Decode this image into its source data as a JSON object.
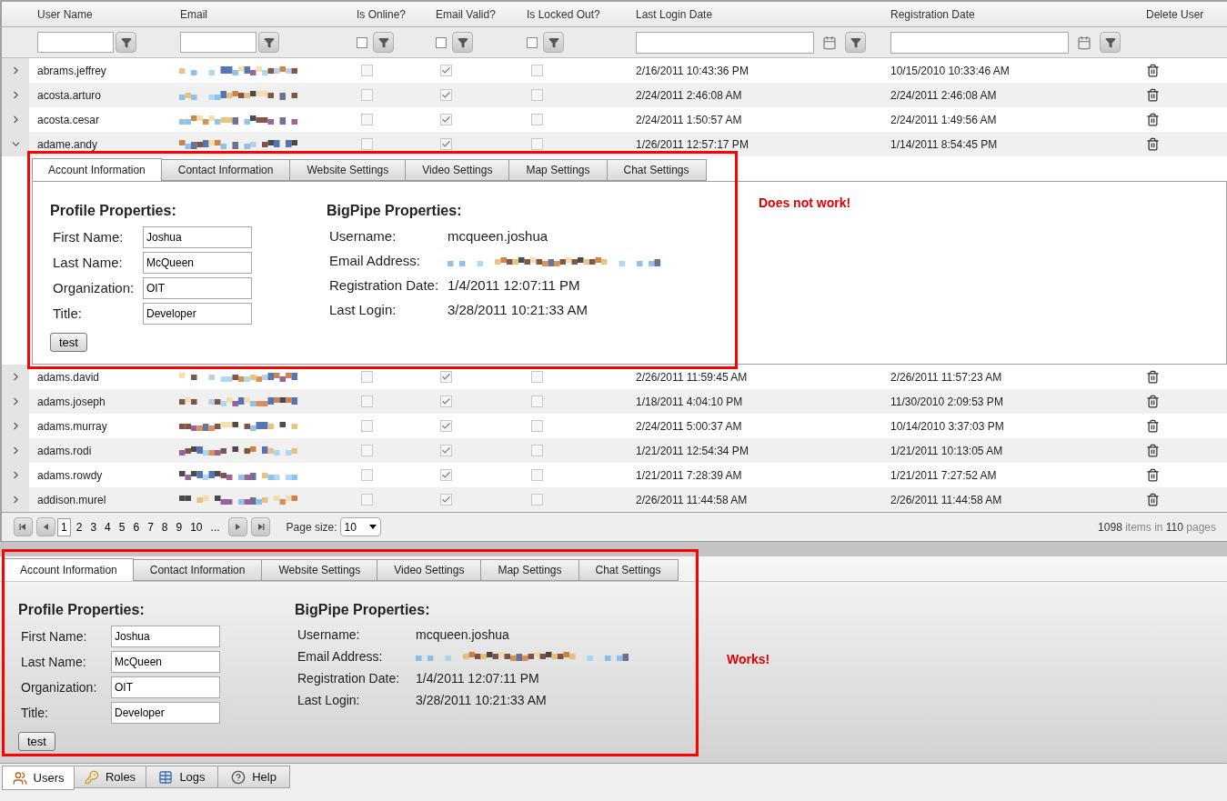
{
  "grid": {
    "checkbox_filters": [
      {
        "checked": false
      },
      {
        "checked": false
      },
      {
        "checked": false
      }
    ],
    "columns": [
      "User Name",
      "Email",
      "Is Online?",
      "Email Valid?",
      "Is Locked Out?",
      "Last Login Date",
      "Registration Date",
      "Delete User"
    ],
    "rows_before": [
      {
        "user": "abrams.jeffrey",
        "online": false,
        "valid": true,
        "locked": false,
        "last_login": "2/16/2011 10:43:36 PM",
        "registered": "10/15/2010 10:33:46 AM",
        "expanded": false
      },
      {
        "user": "acosta.arturo",
        "online": false,
        "valid": true,
        "locked": false,
        "last_login": "2/24/2011 2:46:08 AM",
        "registered": "2/24/2011 2:46:08 AM",
        "expanded": false
      },
      {
        "user": "acosta.cesar",
        "online": false,
        "valid": true,
        "locked": false,
        "last_login": "2/24/2011 1:50:57 AM",
        "registered": "2/24/2011 1:49:56 AM",
        "expanded": false
      },
      {
        "user": "adame.andy",
        "online": false,
        "valid": true,
        "locked": false,
        "last_login": "1/26/2011 12:57:17 PM",
        "registered": "1/14/2011 8:54:45 PM",
        "expanded": true
      }
    ],
    "rows_after": [
      {
        "user": "adams.david",
        "online": false,
        "valid": true,
        "locked": false,
        "last_login": "2/26/2011 11:59:45 AM",
        "registered": "2/26/2011 11:57:23 AM",
        "expanded": false
      },
      {
        "user": "adams.joseph",
        "online": false,
        "valid": true,
        "locked": false,
        "last_login": "1/18/2011 4:04:10 PM",
        "registered": "11/30/2010 2:09:53 PM",
        "expanded": false
      },
      {
        "user": "adams.murray",
        "online": false,
        "valid": true,
        "locked": false,
        "last_login": "2/24/2011 5:00:37 AM",
        "registered": "10/14/2010 3:37:03 PM",
        "expanded": false
      },
      {
        "user": "adams.rodi",
        "online": false,
        "valid": true,
        "locked": false,
        "last_login": "1/21/2011 12:54:34 PM",
        "registered": "1/21/2011 10:13:05 AM",
        "expanded": false
      },
      {
        "user": "adams.rowdy",
        "online": false,
        "valid": true,
        "locked": false,
        "last_login": "1/21/2011 7:28:39 AM",
        "registered": "1/21/2011 7:27:52 AM",
        "expanded": false
      },
      {
        "user": "addison.murel",
        "online": false,
        "valid": true,
        "locked": false,
        "last_login": "2/26/2011 11:44:58 AM",
        "registered": "2/26/2011 11:44:58 AM",
        "expanded": false
      }
    ]
  },
  "detail_panel": {
    "tabs": [
      {
        "label": "Account Information",
        "selected": true
      },
      {
        "label": "Contact Information",
        "selected": false
      },
      {
        "label": "Website Settings",
        "selected": false
      },
      {
        "label": "Video Settings",
        "selected": false
      },
      {
        "label": "Map Settings",
        "selected": false
      },
      {
        "label": "Chat Settings",
        "selected": false
      }
    ],
    "profile_title": "Profile Properties:",
    "profile_fields": [
      {
        "label": "First Name:",
        "value": "Joshua"
      },
      {
        "label": "Last Name:",
        "value": "McQueen"
      },
      {
        "label": "Organization:",
        "value": "OIT"
      },
      {
        "label": "Title:",
        "value": "Developer"
      }
    ],
    "button": "test",
    "bigpipe_title": "BigPipe Properties:",
    "bigpipe_fields": [
      {
        "label": "Username:",
        "value": "mcqueen.joshua"
      },
      {
        "label": "Email Address:"
      },
      {
        "label": "Registration Date:",
        "value": "1/4/2011 12:07:11 PM"
      },
      {
        "label": "Last Login:",
        "value": "3/28/2011 10:21:33 AM"
      }
    ],
    "note": "Does not work!"
  },
  "pager": {
    "pages": [
      {
        "label": "1",
        "selected": true
      },
      {
        "label": "2",
        "selected": false
      },
      {
        "label": "3",
        "selected": false
      },
      {
        "label": "4",
        "selected": false
      },
      {
        "label": "5",
        "selected": false
      },
      {
        "label": "6",
        "selected": false
      },
      {
        "label": "7",
        "selected": false
      },
      {
        "label": "8",
        "selected": false
      },
      {
        "label": "9",
        "selected": false
      },
      {
        "label": "10",
        "selected": false
      },
      {
        "label": "...",
        "selected": false
      }
    ],
    "page_size_label": "Page size:",
    "page_size": "10",
    "summary": [
      "1098",
      "items in",
      "110",
      "pages"
    ]
  },
  "bottom_panel": {
    "tabs": [
      {
        "label": "Account Information",
        "selected": true
      },
      {
        "label": "Contact Information",
        "selected": false
      },
      {
        "label": "Website Settings",
        "selected": false
      },
      {
        "label": "Video Settings",
        "selected": false
      },
      {
        "label": "Map Settings",
        "selected": false
      },
      {
        "label": "Chat Settings",
        "selected": false
      }
    ],
    "profile_title": "Profile Properties:",
    "profile_fields": [
      {
        "label": "First Name:",
        "value": "Joshua"
      },
      {
        "label": "Last Name:",
        "value": "McQueen"
      },
      {
        "label": "Organization:",
        "value": "OIT"
      },
      {
        "label": "Title:",
        "value": "Developer"
      }
    ],
    "button": "test",
    "bigpipe_title": "BigPipe Properties:",
    "bigpipe_fields": [
      {
        "label": "Username:",
        "value": "mcqueen.joshua"
      },
      {
        "label": "Email Address:"
      },
      {
        "label": "Registration Date:",
        "value": "1/4/2011 12:07:11 PM"
      },
      {
        "label": "Last Login:",
        "value": "3/28/2011 10:21:33 AM"
      }
    ],
    "note": "Works!"
  },
  "app_tabs": [
    {
      "label": "Users",
      "selected": true
    },
    {
      "label": "Roles",
      "selected": false
    },
    {
      "label": "Logs",
      "selected": false
    },
    {
      "label": "Help",
      "selected": false
    }
  ]
}
